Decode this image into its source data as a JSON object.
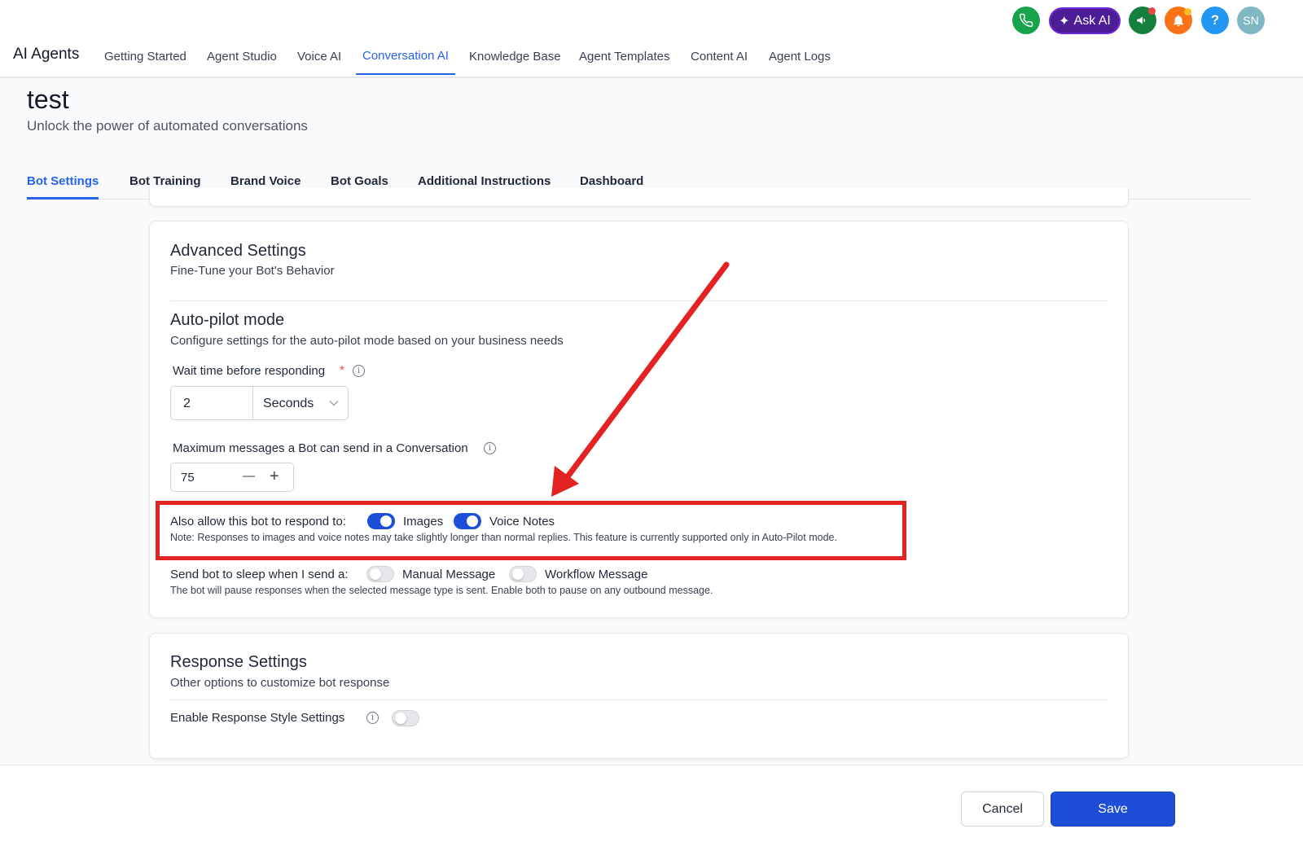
{
  "header": {
    "brand": "AI Agents",
    "nav": [
      {
        "label": "Getting Started"
      },
      {
        "label": "Agent Studio"
      },
      {
        "label": "Voice AI"
      },
      {
        "label": "Conversation AI"
      },
      {
        "label": "Knowledge Base"
      },
      {
        "label": "Agent Templates"
      },
      {
        "label": "Content AI"
      },
      {
        "label": "Agent Logs"
      }
    ],
    "active_nav": "Conversation AI",
    "ask_ai_label": "Ask AI",
    "help_label": "?",
    "avatar_initials": "SN"
  },
  "page": {
    "title": "test",
    "subtitle": "Unlock the power of automated conversations",
    "tabs": [
      {
        "label": "Bot Settings"
      },
      {
        "label": "Bot Training"
      },
      {
        "label": "Brand Voice"
      },
      {
        "label": "Bot Goals"
      },
      {
        "label": "Additional Instructions"
      },
      {
        "label": "Dashboard"
      }
    ],
    "active_tab": "Bot Settings"
  },
  "advanced": {
    "title": "Advanced Settings",
    "description": "Fine-Tune your Bot's Behavior",
    "autopilot": {
      "title": "Auto-pilot mode",
      "description": "Configure settings for the auto-pilot mode based on your business needs",
      "wait_label": "Wait time before responding",
      "required_mark": "*",
      "wait_value": "2",
      "wait_unit": "Seconds",
      "max_label": "Maximum messages a Bot can send in a Conversation",
      "max_value": "75",
      "minus": "—",
      "plus": "+"
    },
    "respond": {
      "label": "Also allow this bot to respond to:",
      "images_label": "Images",
      "images_on": true,
      "voice_label": "Voice Notes",
      "voice_on": true,
      "note": "Note: Responses to images and voice notes may take slightly longer than normal replies. This feature is currently supported only in Auto-Pilot mode."
    },
    "sleep": {
      "label": "Send bot to sleep when I send a:",
      "manual_label": "Manual Message",
      "manual_on": false,
      "workflow_label": "Workflow Message",
      "workflow_on": false,
      "note": "The bot will pause responses when the selected message type is sent. Enable both to pause on any outbound message."
    }
  },
  "response": {
    "title": "Response Settings",
    "description": "Other options to customize bot response",
    "style_label": "Enable Response Style Settings",
    "style_on": false
  },
  "footer": {
    "cancel": "Cancel",
    "save": "Save"
  },
  "colors": {
    "accent": "#2563eb",
    "primary_button": "#1d4ed8",
    "annotation": "#e32222",
    "phone": "#16a34a",
    "ask_ai": "#4c1d95",
    "announce": "#15803d",
    "bell": "#f97316",
    "help": "#2196f3",
    "avatar": "#7fb8c2"
  }
}
